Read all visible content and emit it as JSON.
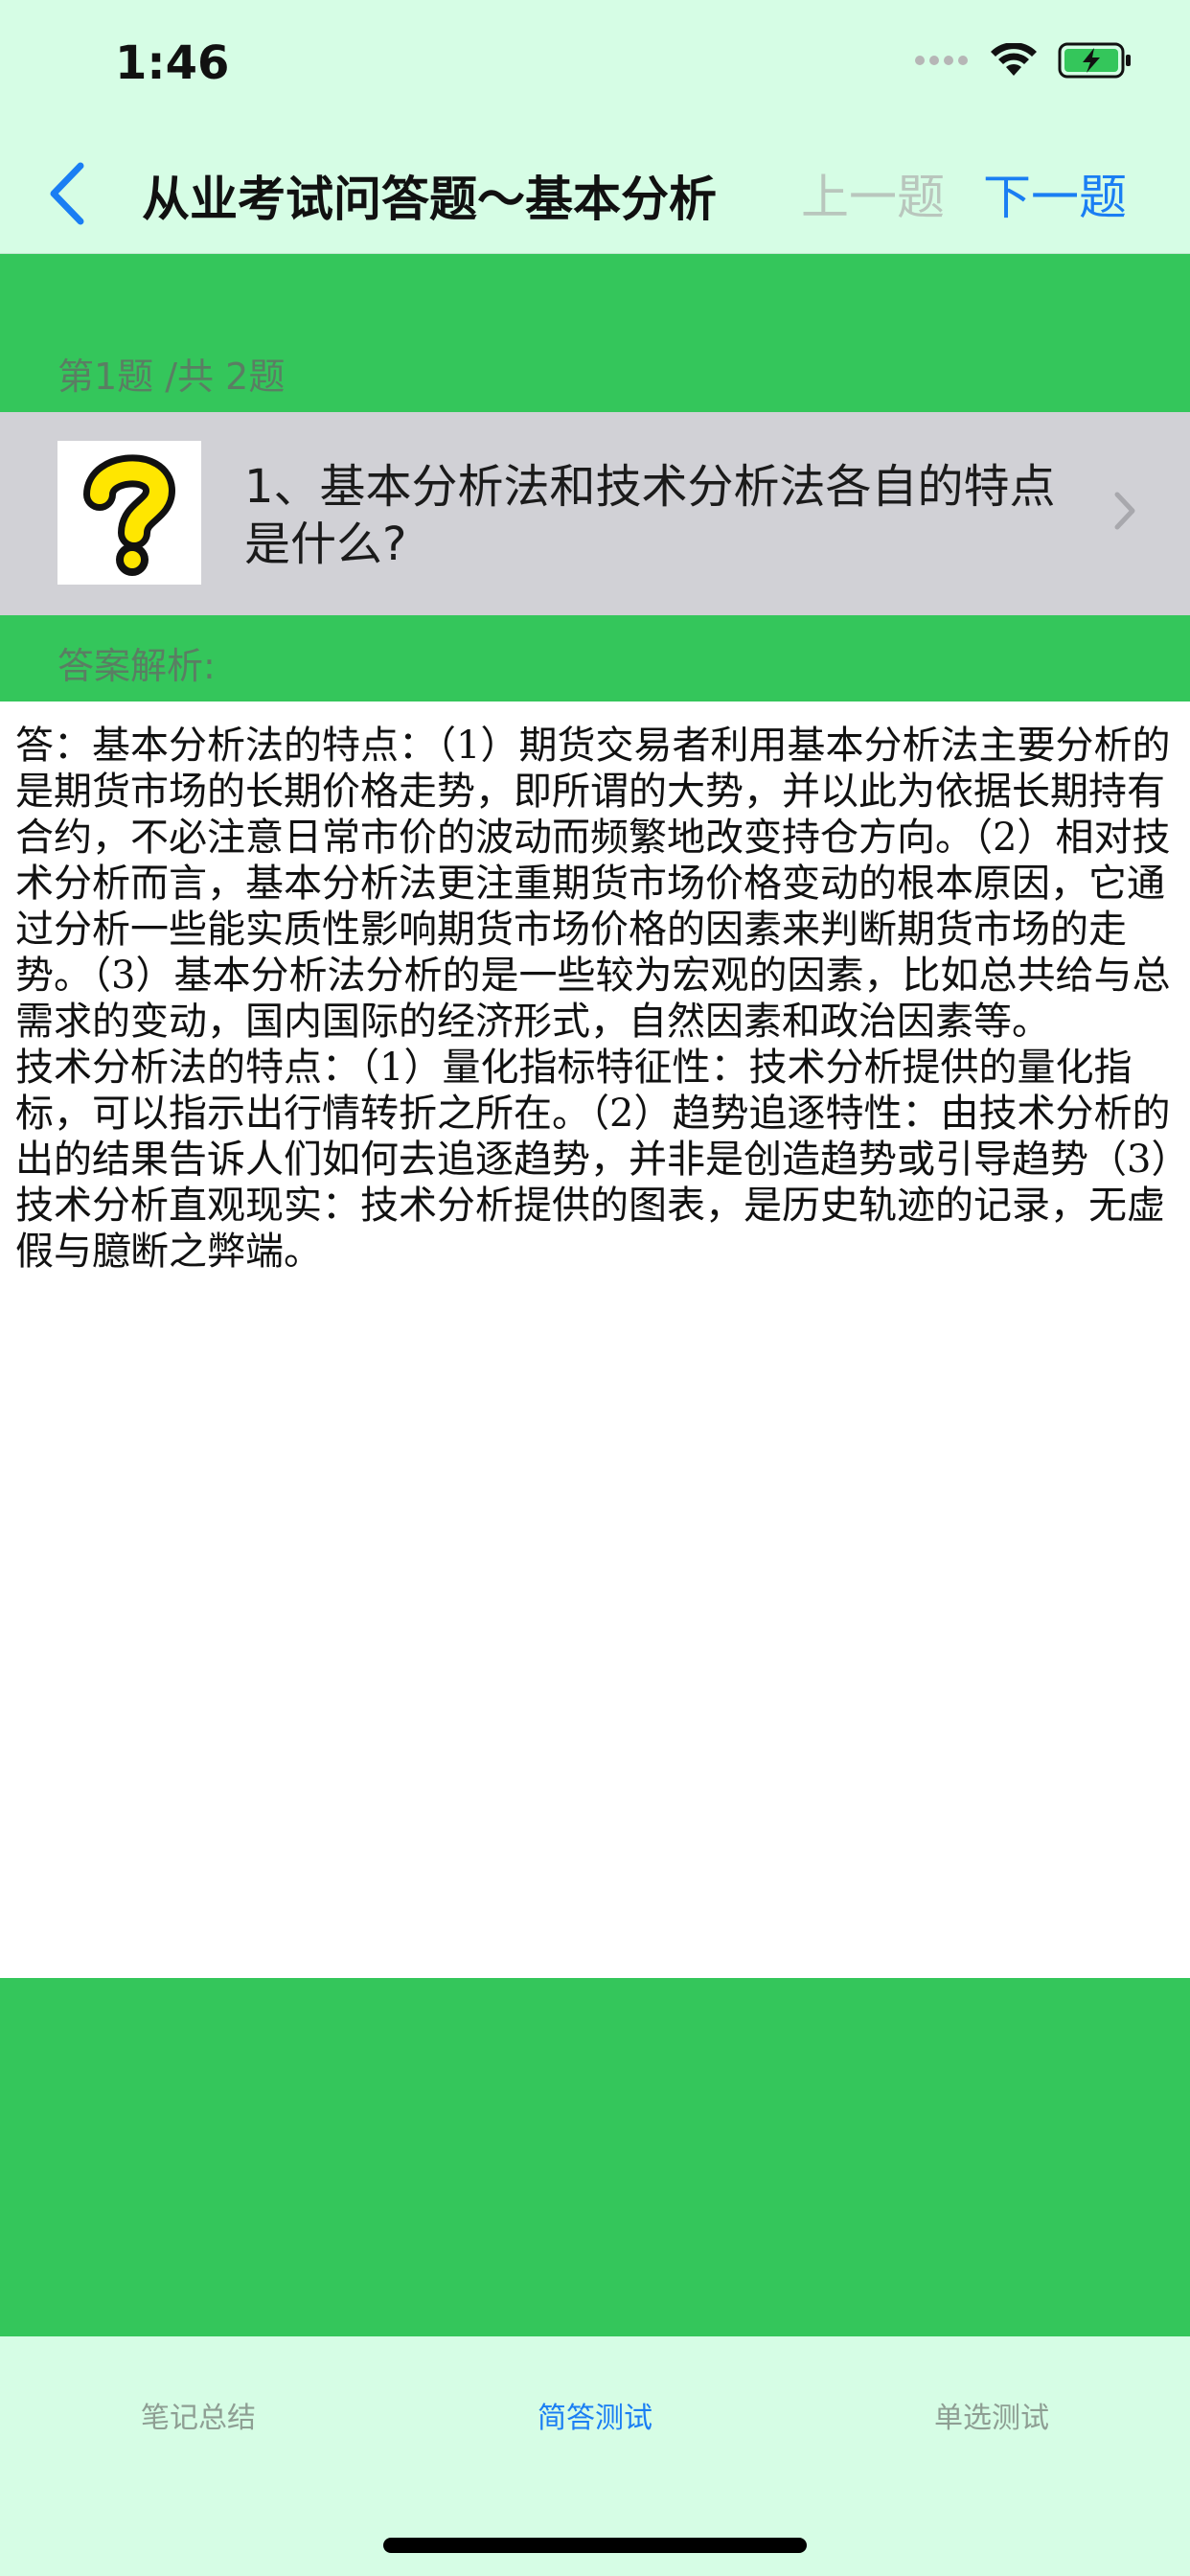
{
  "status_bar": {
    "time": "1:46"
  },
  "nav": {
    "title": "从业考试问答题～基本分析",
    "prev_label": "上一题",
    "next_label": "下一题"
  },
  "counter": "第1题 /共 2题",
  "question": {
    "text": "1、基本分析法和技术分析法各自的特点是什么?"
  },
  "answer_label": "答案解析:",
  "answer_text": "答：基本分析法的特点：（1）期货交易者利用基本分析法主要分析的是期货市场的长期价格走势，即所谓的大势，并以此为依据长期持有合约，不必注意日常市价的波动而频繁地改变持仓方向。（2）相对技术分析而言，基本分析法更注重期货市场价格变动的根本原因，它通过分析一些能实质性影响期货市场价格的因素来判断期货市场的走势。（3）基本分析法分析的是一些较为宏观的因素，比如总共给与总需求的变动，国内国际的经济形式，自然因素和政治因素等。\n技术分析法的特点：（1）量化指标特征性：技术分析提供的量化指标，可以指示出行情转折之所在。（2）趋势追逐特性：由技术分析的出的结果告诉人们如何去追逐趋势，并非是创造趋势或引导趋势（3）技术分析直观现实：技术分析提供的图表，是历史轨迹的记录，无虚假与臆断之弊端。",
  "tabs": [
    {
      "label": "笔记总结"
    },
    {
      "label": "简答测试"
    },
    {
      "label": "单选测试"
    }
  ],
  "colors": {
    "accent": "#1a7ef3",
    "green": "#34c65b",
    "background": "#d6fde5",
    "question_row": "#d1d1d6"
  },
  "icons": [
    "back-chevron-icon",
    "wifi-icon",
    "battery-icon",
    "question-mark-icon",
    "chevron-right-icon"
  ]
}
